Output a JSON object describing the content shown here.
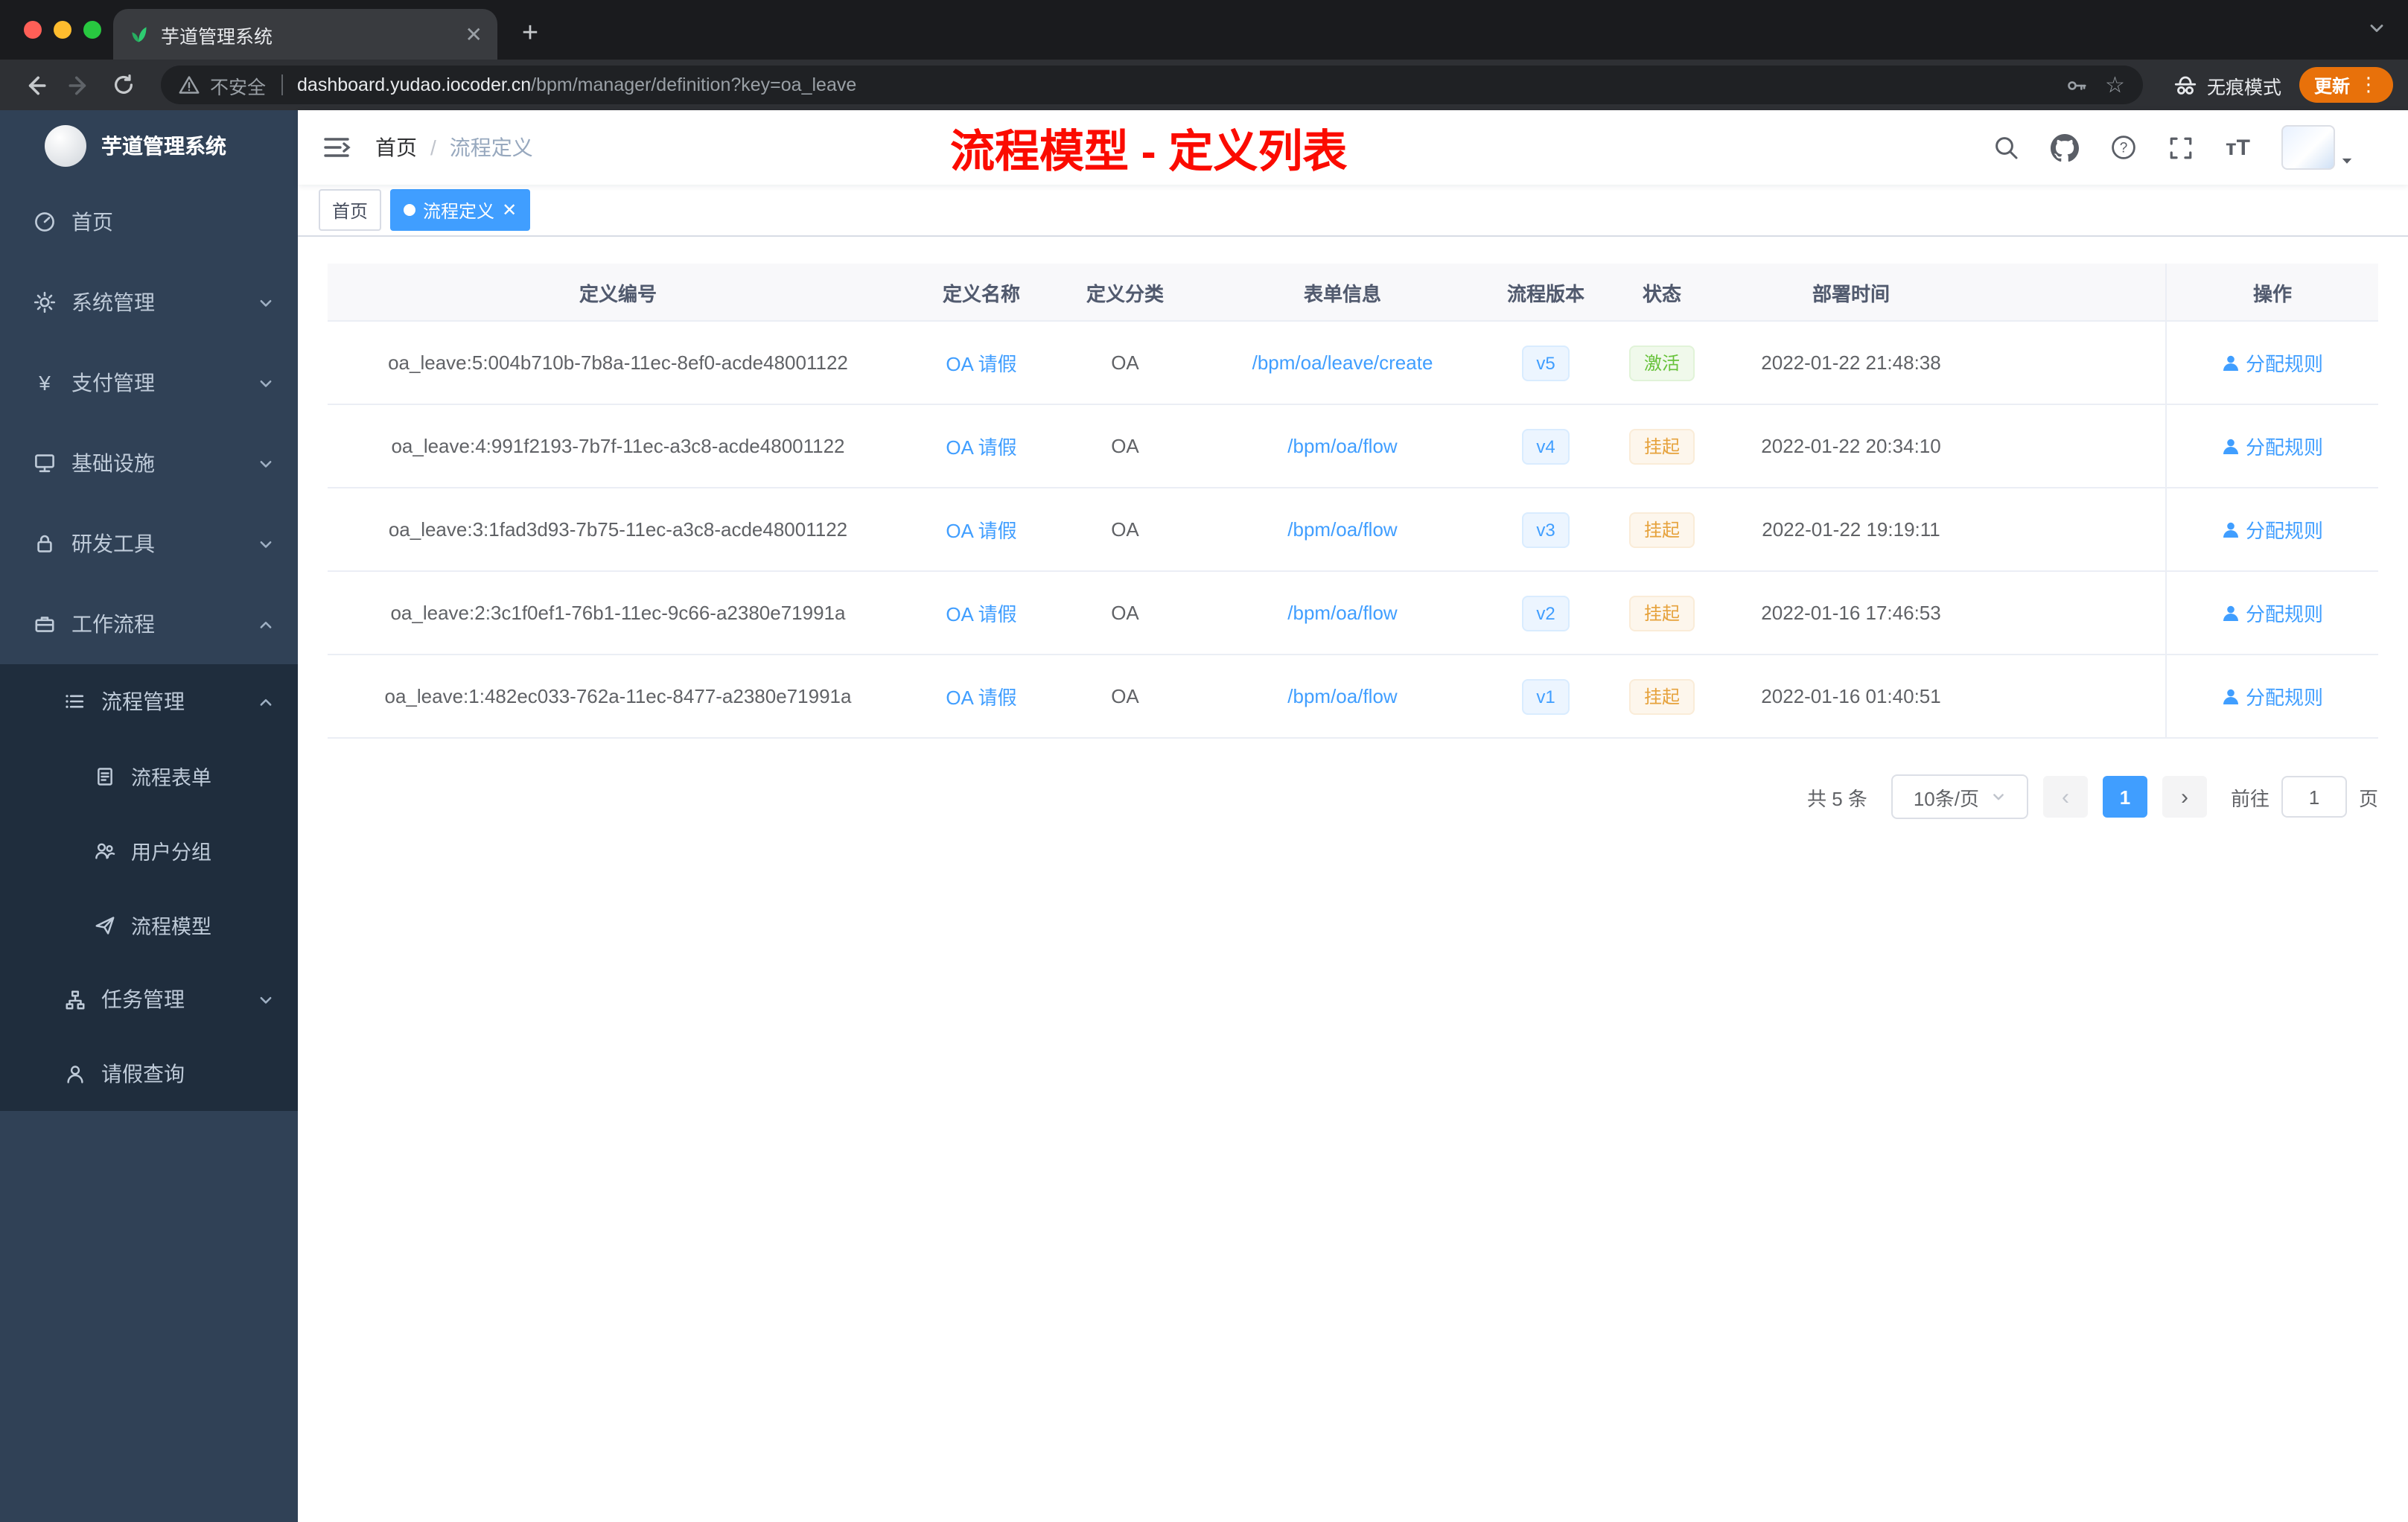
{
  "browser": {
    "tab_title": "芋道管理系统",
    "security_label": "不安全",
    "url_host": "dashboard.yudao.iocoder.cn",
    "url_path": "/bpm/manager/definition?key=oa_leave",
    "incognito_label": "无痕模式",
    "update_label": "更新"
  },
  "sidebar": {
    "logo_title": "芋道管理系统",
    "items": [
      {
        "label": "首页",
        "icon": "dashboard-icon"
      },
      {
        "label": "系统管理",
        "icon": "gear-icon"
      },
      {
        "label": "支付管理",
        "icon": "payment-icon"
      },
      {
        "label": "基础设施",
        "icon": "infrastructure-icon"
      },
      {
        "label": "研发工具",
        "icon": "devtools-icon"
      },
      {
        "label": "工作流程",
        "icon": "workflow-icon"
      },
      {
        "label": "流程管理",
        "icon": "process-manage-icon"
      },
      {
        "label": "流程表单",
        "icon": "form-icon"
      },
      {
        "label": "用户分组",
        "icon": "user-group-icon"
      },
      {
        "label": "流程模型",
        "icon": "process-model-icon"
      },
      {
        "label": "任务管理",
        "icon": "task-icon"
      },
      {
        "label": "请假查询",
        "icon": "leave-query-icon"
      }
    ]
  },
  "header": {
    "breadcrumb_home": "首页",
    "breadcrumb_sep": "/",
    "breadcrumb_current": "流程定义",
    "annotation": "流程模型 - 定义列表"
  },
  "tags": {
    "home": "首页",
    "active": "流程定义"
  },
  "table": {
    "columns": [
      "定义编号",
      "定义名称",
      "定义分类",
      "表单信息",
      "流程版本",
      "状态",
      "部署时间",
      "操作"
    ],
    "rows": [
      {
        "id": "oa_leave:5:004b710b-7b8a-11ec-8ef0-acde48001122",
        "name": "OA 请假",
        "category": "OA",
        "form": "/bpm/oa/leave/create",
        "version": "v5",
        "status": "激活",
        "status_type": "success",
        "time": "2022-01-22 21:48:38",
        "action": "分配规则"
      },
      {
        "id": "oa_leave:4:991f2193-7b7f-11ec-a3c8-acde48001122",
        "name": "OA 请假",
        "category": "OA",
        "form": "/bpm/oa/flow",
        "version": "v4",
        "status": "挂起",
        "status_type": "warning",
        "time": "2022-01-22 20:34:10",
        "action": "分配规则"
      },
      {
        "id": "oa_leave:3:1fad3d93-7b75-11ec-a3c8-acde48001122",
        "name": "OA 请假",
        "category": "OA",
        "form": "/bpm/oa/flow",
        "version": "v3",
        "status": "挂起",
        "status_type": "warning",
        "time": "2022-01-22 19:19:11",
        "action": "分配规则"
      },
      {
        "id": "oa_leave:2:3c1f0ef1-76b1-11ec-9c66-a2380e71991a",
        "name": "OA 请假",
        "category": "OA",
        "form": "/bpm/oa/flow",
        "version": "v2",
        "status": "挂起",
        "status_type": "warning",
        "time": "2022-01-16 17:46:53",
        "action": "分配规则"
      },
      {
        "id": "oa_leave:1:482ec033-762a-11ec-8477-a2380e71991a",
        "name": "OA 请假",
        "category": "OA",
        "form": "/bpm/oa/flow",
        "version": "v1",
        "status": "挂起",
        "status_type": "warning",
        "time": "2022-01-16 01:40:51",
        "action": "分配规则"
      }
    ]
  },
  "pagination": {
    "total": "共 5 条",
    "page_size": "10条/页",
    "current_page": "1",
    "goto_label": "前往",
    "goto_value": "1",
    "page_unit": "页"
  },
  "colors": {
    "accent_blue": "#409eff",
    "success_green": "#67c23a",
    "warning_orange": "#e6a23c",
    "annotation_red": "#fb0b00",
    "sidebar_bg": "#304156",
    "submenu_bg": "#1f2d3d"
  }
}
